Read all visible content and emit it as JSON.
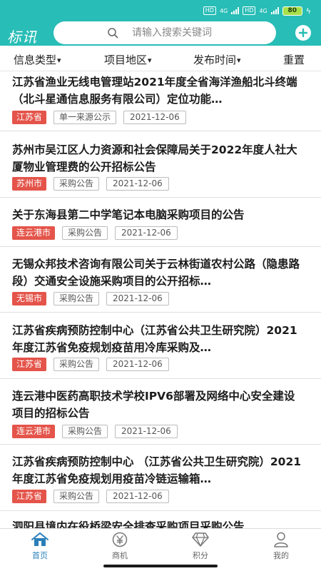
{
  "status_bar": {
    "hd1": "HD",
    "net1": "4G",
    "hd2": "HD",
    "net2": "4G",
    "battery": "80",
    "charging_icon": "bolt-icon"
  },
  "header": {
    "app_title": "标讯",
    "search_placeholder": "请输入搜索关键词",
    "search_icon": "search-icon",
    "add_icon": "plus-circle-icon",
    "bg_color": "#28bdb6"
  },
  "filters": [
    {
      "label": "信息类型",
      "caret": "▾"
    },
    {
      "label": "项目地区",
      "caret": "▾"
    },
    {
      "label": "发布时间",
      "caret": "▾"
    },
    {
      "label": "重置",
      "caret": ""
    }
  ],
  "list": [
    {
      "title": "江苏省渔业无线电管理站2021年度全省海洋渔船北斗终端（北斗星通信息服务有限公司）定位功能…",
      "region": "江苏省",
      "type": "单一来源公示",
      "date": "2021-12-06"
    },
    {
      "title": "苏州市吴江区人力资源和社会保障局关于2022年度人社大厦物业管理费的公开招标公告",
      "region": "苏州市",
      "type": "采购公告",
      "date": "2021-12-06"
    },
    {
      "title": "关于东海县第二中学笔记本电脑采购项目的公告",
      "region": "连云港市",
      "type": "采购公告",
      "date": "2021-12-06"
    },
    {
      "title": "无锡众邦技术咨询有限公司关于云林街道农村公路（隐患路段）交通安全设施采购项目的公开招标…",
      "region": "无锡市",
      "type": "采购公告",
      "date": "2021-12-06"
    },
    {
      "title": "江苏省疾病预防控制中心（江苏省公共卫生研究院）2021年度江苏省免疫规划疫苗用冷库采购及…",
      "region": "江苏省",
      "type": "采购公告",
      "date": "2021-12-06"
    },
    {
      "title": "连云港中医药高职技术学校IPV6部署及网络中心安全建设项目的招标公告",
      "region": "连云港市",
      "type": "采购公告",
      "date": "2021-12-06"
    },
    {
      "title": "江苏省疾病预防控制中心 （江苏省公共卫生研究院）2021年度江苏省免疫规划用疫苗冷链运输箱…",
      "region": "江苏省",
      "type": "采购公告",
      "date": "2021-12-06"
    },
    {
      "title": "泗阳县境内在役桥梁安全排查采购项目采购公告",
      "region": "",
      "type": "",
      "date": ""
    }
  ],
  "bottom_nav": [
    {
      "label": "首页",
      "icon": "home-icon",
      "active": true
    },
    {
      "label": "商机",
      "icon": "yen-icon",
      "active": false
    },
    {
      "label": "积分",
      "icon": "diamond-icon",
      "active": false
    },
    {
      "label": "我的",
      "icon": "user-icon",
      "active": false
    }
  ],
  "colors": {
    "brand": "#28bdb6",
    "region_tag": "#e4544a",
    "nav_active": "#2a7fb8"
  }
}
